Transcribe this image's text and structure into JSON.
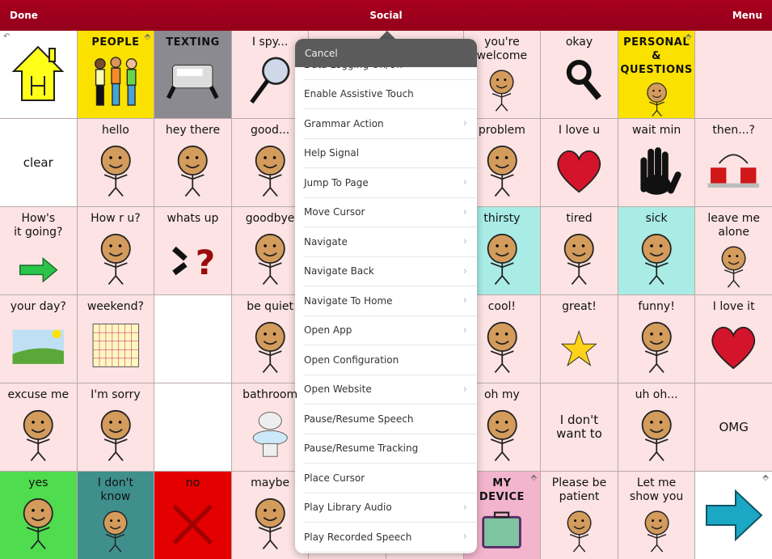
{
  "topbar": {
    "done": "Done",
    "title": "Social",
    "menu": "Menu"
  },
  "colors": {
    "header": "#a0001c",
    "pink": "#fde3e3",
    "yellow": "#fbe100",
    "gray": "#8b8a90",
    "cyan": "#a9ece6",
    "green": "#4fdc4f",
    "teal": "#3f8f8d",
    "red": "#e40000",
    "white": "#ffffff"
  },
  "cells": [
    {
      "label": "",
      "bg": "white",
      "icon": "house",
      "corner": "back"
    },
    {
      "label": "PEOPLE",
      "bg": "yellow",
      "icon": "people",
      "caps": true,
      "corner": "folder"
    },
    {
      "label": "TEXTING",
      "bg": "gray",
      "icon": "phone",
      "caps": true
    },
    {
      "label": "I spy...",
      "icon": "magnifier"
    },
    {
      "label": "",
      "hidden": true
    },
    {
      "label": "",
      "hidden": true
    },
    {
      "label": "you're\nwelcome",
      "icon": "face"
    },
    {
      "label": "okay",
      "icon": "hand-ok"
    },
    {
      "label": "PERSONAL &\nQUESTIONS",
      "bg": "yellow",
      "icon": "face",
      "caps": true,
      "corner": "folder"
    },
    {
      "label": "",
      "hidden": true
    },
    {
      "label": "clear",
      "bg": "white",
      "center": true
    },
    {
      "label": "hello",
      "icon": "face"
    },
    {
      "label": "hey there",
      "icon": "face"
    },
    {
      "label": "good...",
      "icon": "face"
    },
    {
      "label": "",
      "hidden": true
    },
    {
      "label": "",
      "hidden": true
    },
    {
      "label": "problem",
      "icon": "face"
    },
    {
      "label": "I love u",
      "icon": "heart"
    },
    {
      "label": "wait min",
      "icon": "hand"
    },
    {
      "label": "then...?",
      "icon": "blocks"
    },
    {
      "label": "How's\nit going?",
      "icon": "arrow-green"
    },
    {
      "label": "How r u?",
      "icon": "face"
    },
    {
      "label": "whats up",
      "icon": "question"
    },
    {
      "label": "goodbye",
      "icon": "face"
    },
    {
      "label": "",
      "hidden": true
    },
    {
      "label": "",
      "hidden": true
    },
    {
      "label": "thirsty",
      "bg": "cyan",
      "icon": "face"
    },
    {
      "label": "tired",
      "icon": "face"
    },
    {
      "label": "sick",
      "bg": "cyan",
      "icon": "face"
    },
    {
      "label": "leave me\nalone",
      "icon": "face"
    },
    {
      "label": "your day?",
      "icon": "landscape"
    },
    {
      "label": "weekend?",
      "icon": "calendar"
    },
    {
      "label": "",
      "bg": "white"
    },
    {
      "label": "be quiet",
      "icon": "face"
    },
    {
      "label": "",
      "hidden": true
    },
    {
      "label": "",
      "hidden": true
    },
    {
      "label": "cool!",
      "icon": "face"
    },
    {
      "label": "great!",
      "icon": "star"
    },
    {
      "label": "funny!",
      "icon": "face"
    },
    {
      "label": "I love it",
      "icon": "heart"
    },
    {
      "label": "excuse me",
      "icon": "face"
    },
    {
      "label": "I'm sorry",
      "icon": "face"
    },
    {
      "label": "",
      "bg": "white"
    },
    {
      "label": "bathroom",
      "icon": "toilet"
    },
    {
      "label": "",
      "hidden": true
    },
    {
      "label": "",
      "hidden": true
    },
    {
      "label": "oh my",
      "icon": "face"
    },
    {
      "label": "I don't\nwant to",
      "center": true
    },
    {
      "label": "uh oh...",
      "icon": "face"
    },
    {
      "label": "OMG",
      "center": true
    },
    {
      "label": "yes",
      "bg": "green",
      "icon": "face"
    },
    {
      "label": "I don't\nknow",
      "bg": "teal",
      "icon": "face"
    },
    {
      "label": "no",
      "bg": "red",
      "icon": "x"
    },
    {
      "label": "maybe",
      "icon": "face"
    },
    {
      "label": "",
      "hidden": true
    },
    {
      "label": "",
      "hidden": true
    },
    {
      "label": "MY\nDEVICE",
      "bg": "pinkdark",
      "icon": "device",
      "caps": true,
      "corner": "folder"
    },
    {
      "label": "Please be\npatient",
      "icon": "face"
    },
    {
      "label": "Let me\nshow you",
      "icon": "face"
    },
    {
      "label": "",
      "bg": "white",
      "icon": "arrow-blue",
      "corner": "folder"
    }
  ],
  "popover": {
    "cancel": "Cancel",
    "items": [
      {
        "label": "Data Logging On/Off",
        "chevron": false
      },
      {
        "label": "Enable Assistive Touch",
        "chevron": false
      },
      {
        "label": "Grammar Action",
        "chevron": true
      },
      {
        "label": "Help Signal",
        "chevron": false
      },
      {
        "label": "Jump To Page",
        "chevron": true
      },
      {
        "label": "Move Cursor",
        "chevron": true
      },
      {
        "label": "Navigate",
        "chevron": true
      },
      {
        "label": "Navigate Back",
        "chevron": true
      },
      {
        "label": "Navigate To Home",
        "chevron": true
      },
      {
        "label": "Open App",
        "chevron": true
      },
      {
        "label": "Open Configuration",
        "chevron": false
      },
      {
        "label": "Open Website",
        "chevron": true
      },
      {
        "label": "Pause/Resume Speech",
        "chevron": false
      },
      {
        "label": "Pause/Resume Tracking",
        "chevron": false
      },
      {
        "label": "Place Cursor",
        "chevron": false
      },
      {
        "label": "Play Library Audio",
        "chevron": true
      },
      {
        "label": "Play Recorded Speech",
        "chevron": true
      }
    ]
  }
}
